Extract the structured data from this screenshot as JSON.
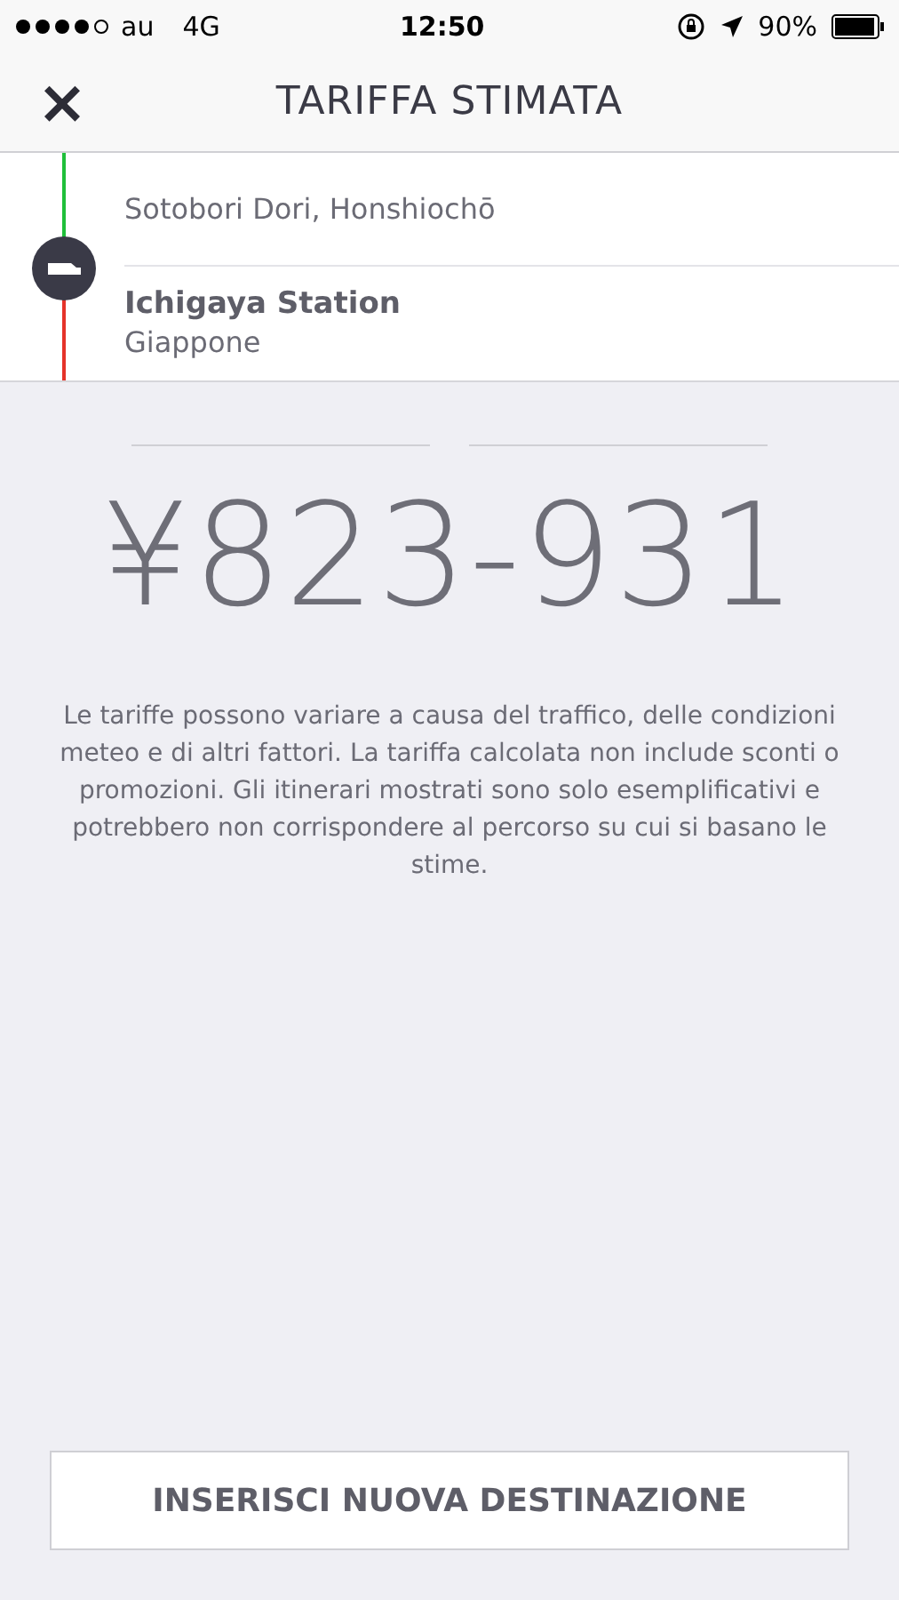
{
  "status_bar": {
    "carrier": "au",
    "network": "4G",
    "time": "12:50",
    "battery": "90%"
  },
  "nav": {
    "close": "×",
    "title": "TARIFFA STIMATA"
  },
  "route": {
    "pickup": "Sotobori Dori, Honshiochō",
    "destination": {
      "name": "Ichigaya Station",
      "country": "Giappone"
    }
  },
  "fare": {
    "price": "¥823-931",
    "disclaimer": "Le tariffe possono variare a causa del traffico, delle condizioni meteo e di altri fattori. La tariffa calcolata non include sconti o promozioni. Gli itinerari mostrati sono solo esemplificativi e potrebbero non corrispondere al percorso su cui si basano le stime."
  },
  "button": "INSERISCI NUOVA DESTINAZIONE"
}
